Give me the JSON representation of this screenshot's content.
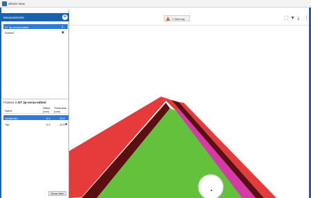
{
  "window": {
    "title": "ZEISS View"
  },
  "measurements": {
    "header": "Measurements",
    "add_symbol": "+",
    "items": [
      {
        "label": "ET 3p-seraa-edited",
        "value": "1"
      },
      {
        "label": "Scene2",
        "value": ""
      }
    ]
  },
  "detail": {
    "prefix": "Frames in",
    "name": "ET 3p-seraa-edited",
    "columns": [
      "Name",
      "Offset (mm)",
      "Thickness (mm)"
    ],
    "rows": [
      {
        "name": "Splatter(b)",
        "offset": "0.0",
        "thickness": "10.0"
      },
      {
        "name": "Top",
        "offset": "0.0",
        "thickness": "10.0"
      }
    ]
  },
  "bottom_button": "Show Item",
  "toolbar": {
    "warning_label": "1 Warning",
    "icons": [
      "select-icon",
      "filter-icon",
      "export-icon",
      "overflow-icon"
    ]
  },
  "colors": {
    "accent": "#1b62ad",
    "selection": "#2f7ad6",
    "plane_green": "#63c13b",
    "wall_red": "#e63b3b",
    "wall_dark": "#5a1010",
    "warning": "#d9651f"
  }
}
